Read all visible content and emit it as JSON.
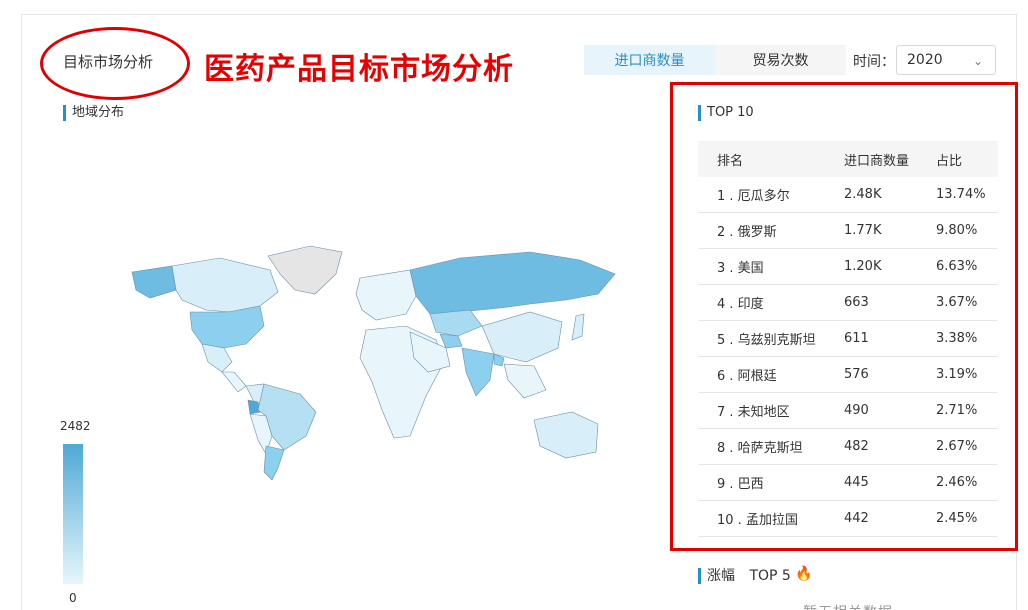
{
  "header": {
    "module_title": "目标市场分析",
    "annotation_heading": "医药产品目标市场分析"
  },
  "toggle": {
    "options": [
      "进口商数量",
      "贸易次数"
    ],
    "active_index": 0
  },
  "time_filter": {
    "label": "时间：",
    "value": "2020"
  },
  "map_section": {
    "title": "地域分布",
    "legend_max": "2482",
    "legend_min": "0",
    "colors": {
      "high": "#4ea9d6",
      "low": "#e8f6fc",
      "none": "#e5e5e5"
    }
  },
  "top10": {
    "title": "TOP 10",
    "columns": [
      "排名",
      "进口商数量",
      "占比"
    ],
    "rows": [
      [
        "1 . 厄瓜多尔",
        "2.48K",
        "13.74%"
      ],
      [
        "2 . 俄罗斯",
        "1.77K",
        "9.80%"
      ],
      [
        "3 . 美国",
        "1.20K",
        "6.63%"
      ],
      [
        "4 . 印度",
        "663",
        "3.67%"
      ],
      [
        "5 . 乌兹别克斯坦",
        "611",
        "3.38%"
      ],
      [
        "6 . 阿根廷",
        "576",
        "3.19%"
      ],
      [
        "7 . 未知地区",
        "490",
        "2.71%"
      ],
      [
        "8 . 哈萨克斯坦",
        "482",
        "2.67%"
      ],
      [
        "9 . 巴西",
        "445",
        "2.46%"
      ],
      [
        "10 . 孟加拉国",
        "442",
        "2.45%"
      ]
    ]
  },
  "growth_section": {
    "title": "涨幅",
    "title_suffix": "TOP 5",
    "icon": "fire-icon",
    "partial_text": "暂无相关数据"
  }
}
